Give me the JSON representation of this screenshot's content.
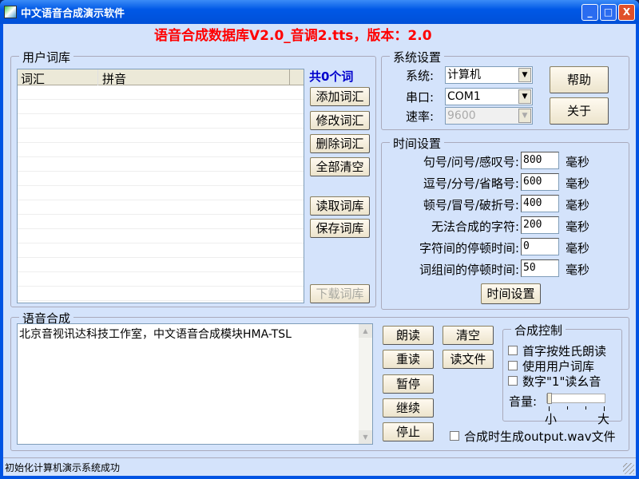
{
  "window": {
    "title": "中文语音合成演示软件",
    "minimize": "_",
    "maximize": "□",
    "close": "X"
  },
  "header": {
    "banner": "语音合成数据库V2.0_音调2.tts，版本：2.0",
    "color": "#ff0000"
  },
  "lexicon": {
    "legend": "用户词库",
    "columns": [
      "词汇",
      "拼音"
    ],
    "count": "共0个词",
    "buttons": {
      "add": "添加词汇",
      "edit": "修改词汇",
      "delete": "删除词汇",
      "clear_all": "全部清空",
      "load": "读取词库",
      "save": "保存词库",
      "download": "下载词库"
    }
  },
  "system": {
    "legend": "系统设置",
    "system_label": "系统:",
    "system_value": "计算机",
    "port_label": "串口:",
    "port_value": "COM1",
    "rate_label": "速率:",
    "rate_value": "9600",
    "help": "帮助",
    "about": "关于"
  },
  "timing": {
    "legend": "时间设置",
    "unit": "毫秒",
    "rows": [
      {
        "label": "句号/问号/感叹号:",
        "value": "800"
      },
      {
        "label": "逗号/分号/省略号:",
        "value": "600"
      },
      {
        "label": "顿号/冒号/破折号:",
        "value": "400"
      },
      {
        "label": "无法合成的字符:",
        "value": "200"
      },
      {
        "label": "字符间的停顿时间:",
        "value": "0"
      },
      {
        "label": "词组间的停顿时间:",
        "value": "50"
      }
    ],
    "apply": "时间设置"
  },
  "synthesis": {
    "legend": "语音合成",
    "text": "北京音视讯达科技工作室，中文语音合成模块HMA-TSL",
    "buttons": {
      "read": "朗读",
      "reread": "重读",
      "pause": "暂停",
      "resume": "继续",
      "stop": "停止",
      "clear": "清空",
      "read_file": "读文件"
    },
    "control": {
      "legend": "合成控制",
      "opt1": "首字按姓氏朗读",
      "opt2": "使用用户词库",
      "opt3": "数字\"1\"读幺音",
      "volume_label": "音量:",
      "vol_min": "小",
      "vol_max": "大",
      "volume": 0
    },
    "wav_option": "合成时生成output.wav文件"
  },
  "status": {
    "text": "初始化计算机演示系统成功"
  }
}
